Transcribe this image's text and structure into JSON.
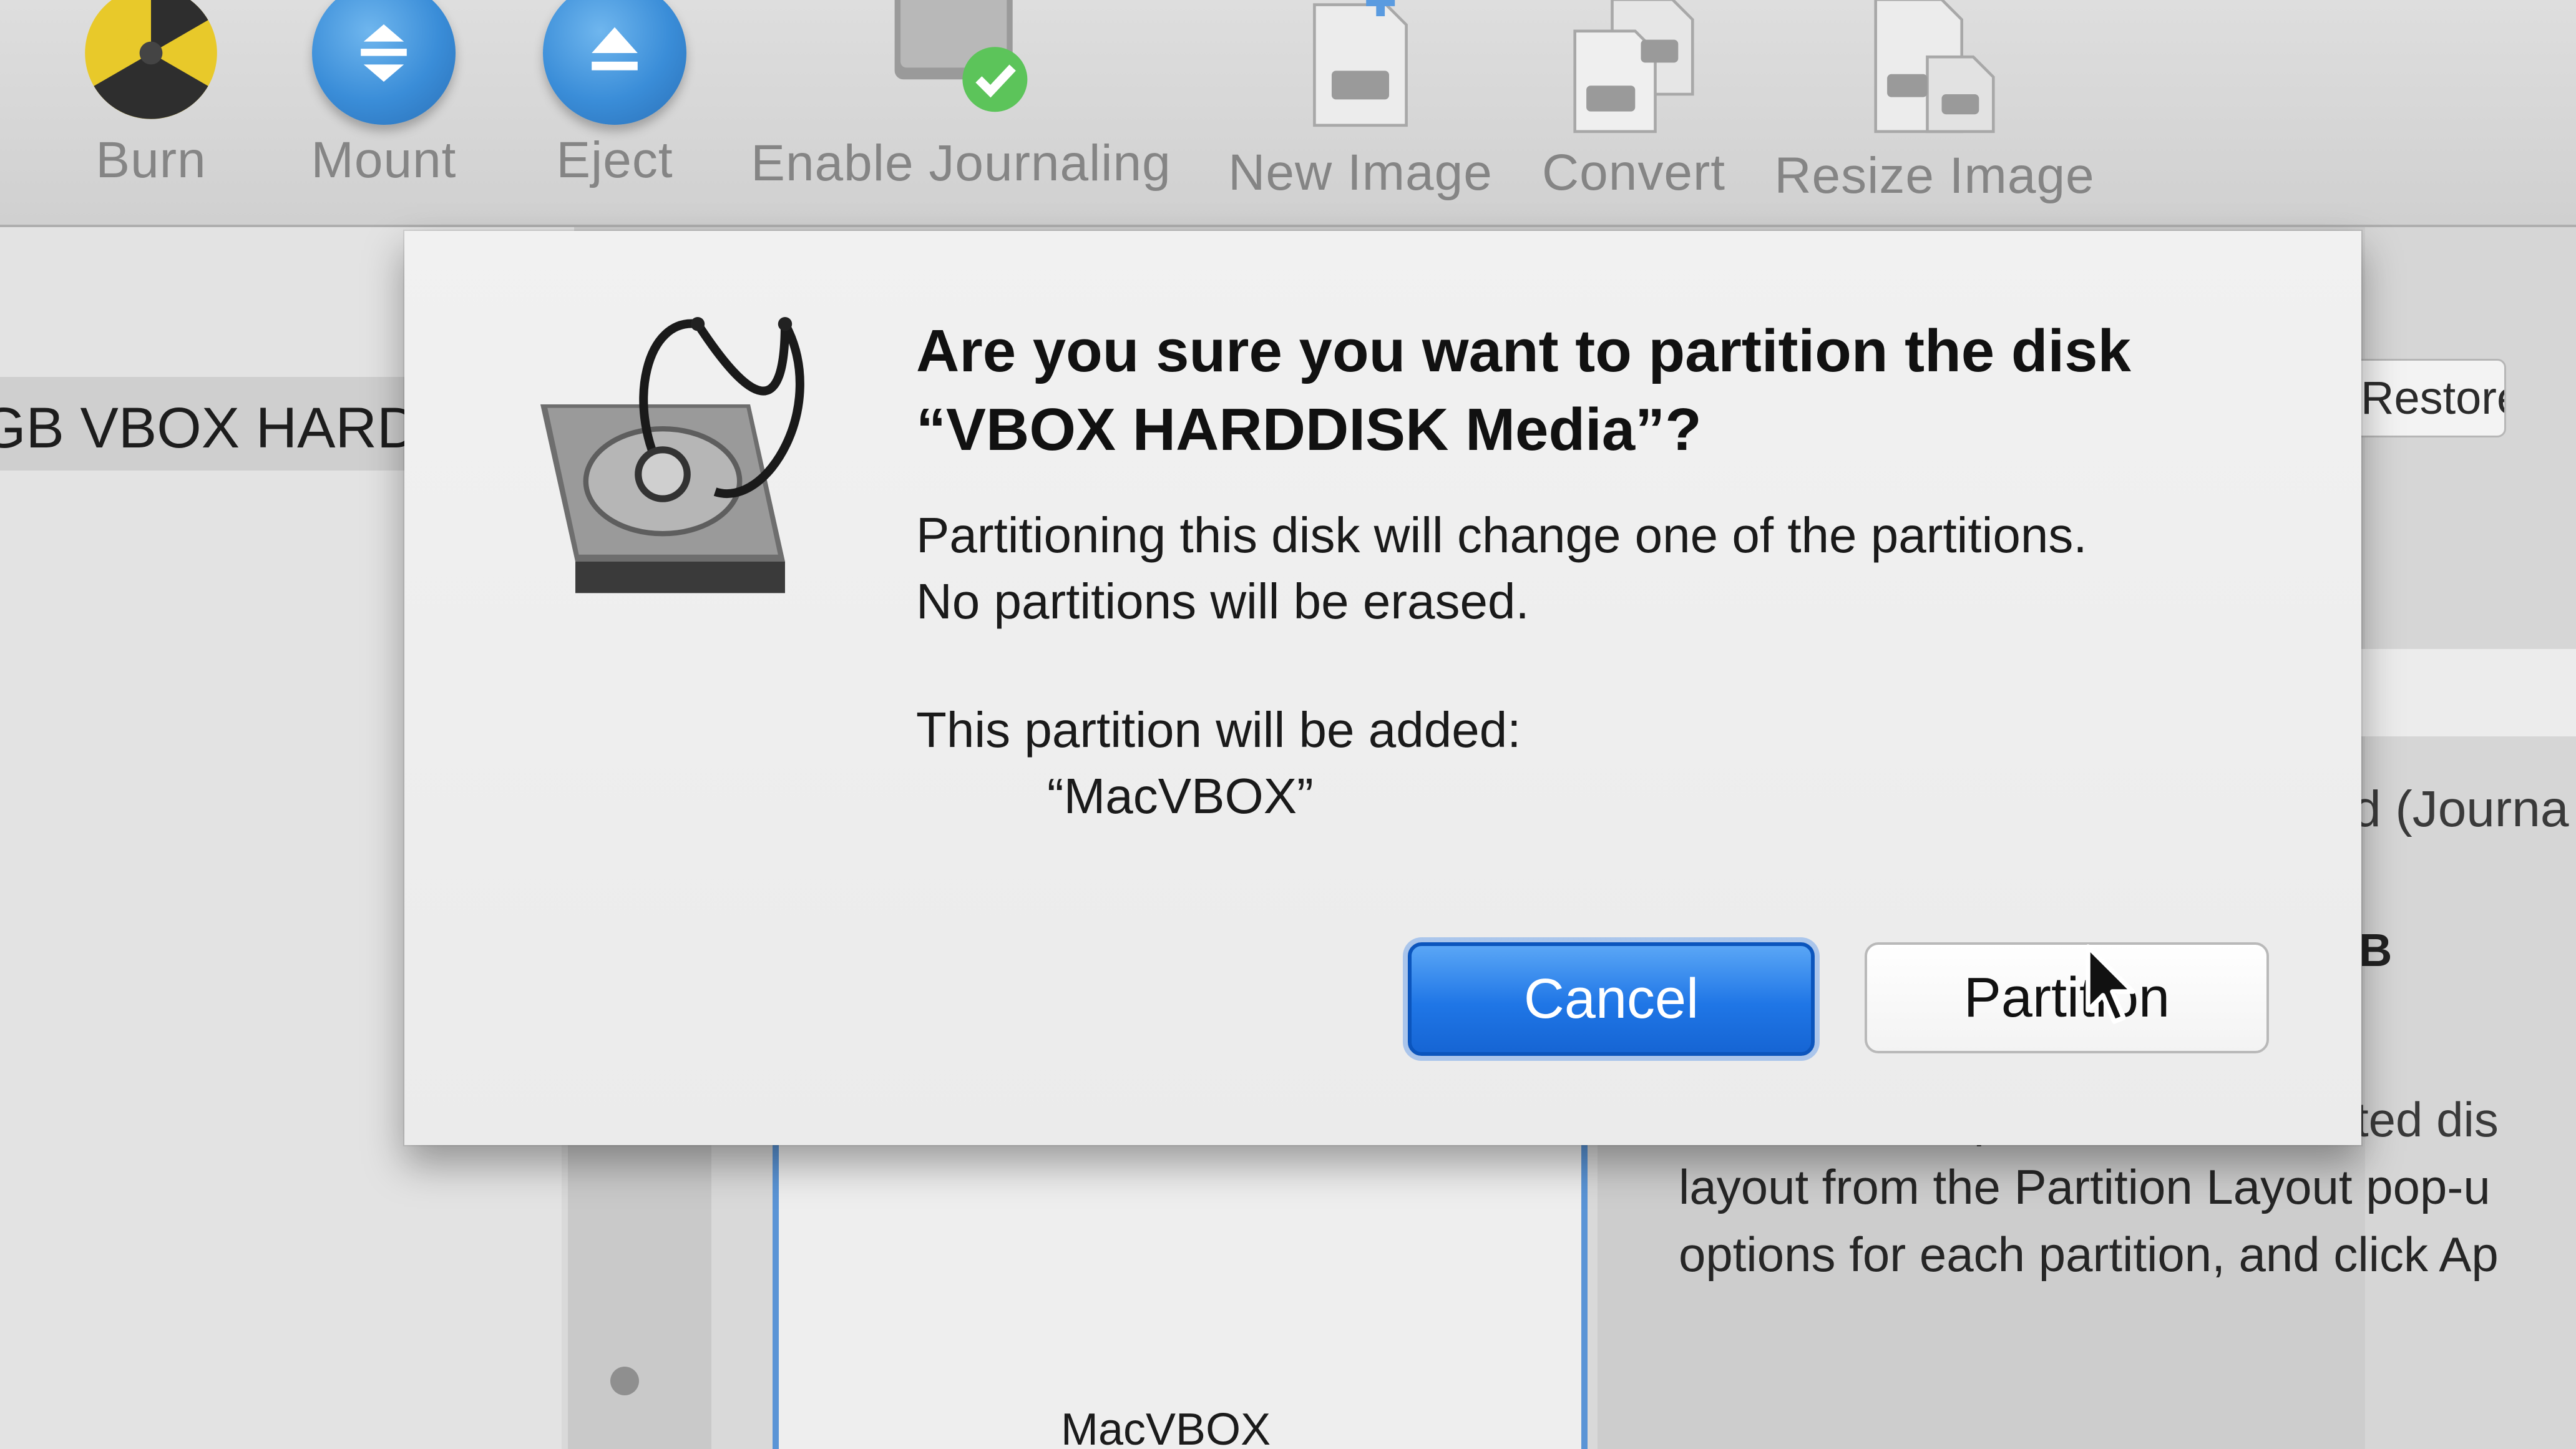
{
  "toolbar": {
    "items": [
      {
        "label": "Burn",
        "icon": "burn-icon"
      },
      {
        "label": "Mount",
        "icon": "mount-icon"
      },
      {
        "label": "Eject",
        "icon": "eject-icon"
      },
      {
        "label": "Enable Journaling",
        "icon": "enable-journaling-icon"
      },
      {
        "label": "New Image",
        "icon": "new-image-icon"
      },
      {
        "label": "Convert",
        "icon": "convert-icon"
      },
      {
        "label": "Resize Image",
        "icon": "resize-image-icon"
      }
    ]
  },
  "sidebar": {
    "selected_disk": "GB VBOX HARD"
  },
  "right_pane": {
    "restore_button": "Restore",
    "format_partial": "d (Journa",
    "size_partial": "B"
  },
  "partition_layout": {
    "partition_name": "MacVBOX"
  },
  "instructions": {
    "line1": "To erase and partition the selected dis",
    "line2": "layout from the Partition Layout pop-u",
    "line3": "options for each partition, and click Ap"
  },
  "dialog": {
    "title": "Are you sure you want to partition the disk “VBOX HARDDISK Media”?",
    "message_line1": "Partitioning this disk will change one of the partitions.",
    "message_line2": "No partitions will be erased.",
    "added_heading": "This partition will be added:",
    "added_partition": "“MacVBOX”",
    "cancel_button": "Cancel",
    "partition_button": "Partition",
    "icon": "disk-utility-icon"
  },
  "colors": {
    "accent_blue": "#1f76e6",
    "journaling_check": "#5cc45a"
  }
}
